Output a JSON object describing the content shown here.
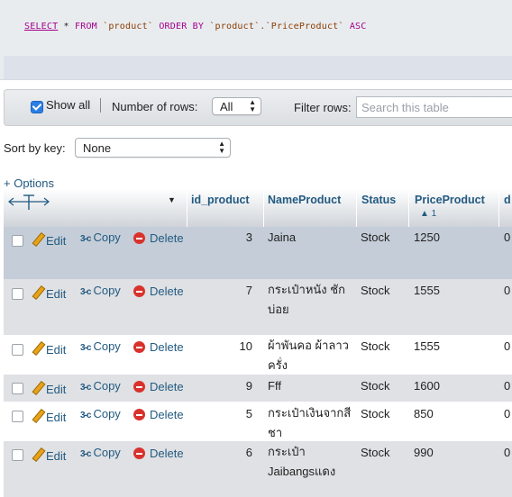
{
  "sql": {
    "select": "SELECT",
    "star": " * ",
    "from": "FROM",
    "table": " `product` ",
    "order_by": "ORDER BY",
    "column": " `product`.`PriceProduct` ",
    "asc": "ASC"
  },
  "nav": {
    "show_all_label": "Show all",
    "show_all_checked": true,
    "rows_label": "Number of rows:",
    "rows_value": "All",
    "filter_label": "Filter rows:",
    "filter_placeholder": "Search this table"
  },
  "sort": {
    "label": "Sort by key:",
    "value": "None"
  },
  "options_link": "+ Options",
  "columns": {
    "id_product": "id_product",
    "name": "NameProduct",
    "status": "Status",
    "price": "PriceProduct",
    "price_sort_indicator": "▲ 1",
    "next": "d"
  },
  "actions": {
    "edit": "Edit",
    "copy": "Copy",
    "delete": "Delete"
  },
  "rows": [
    {
      "id": "3",
      "name": "Jaina",
      "status": "Stock",
      "price": "1250",
      "extra": "0"
    },
    {
      "id": "7",
      "name": "กระเป๋าหนัง ชักบ่อย",
      "status": "Stock",
      "price": "1555",
      "extra": "0"
    },
    {
      "id": "10",
      "name": "ผ้าพันคอ ผ้าลาวครั่ง",
      "status": "Stock",
      "price": "1555",
      "extra": "0"
    },
    {
      "id": "9",
      "name": "Fff",
      "status": "Stock",
      "price": "1600",
      "extra": "0"
    },
    {
      "id": "5",
      "name": "กระเป๋าเงินจากสีชา",
      "status": "Stock",
      "price": "850",
      "extra": "0"
    },
    {
      "id": "6",
      "name": "กระเป๋า Jaibangsแดง",
      "status": "Stock",
      "price": "990",
      "extra": "0"
    }
  ]
}
